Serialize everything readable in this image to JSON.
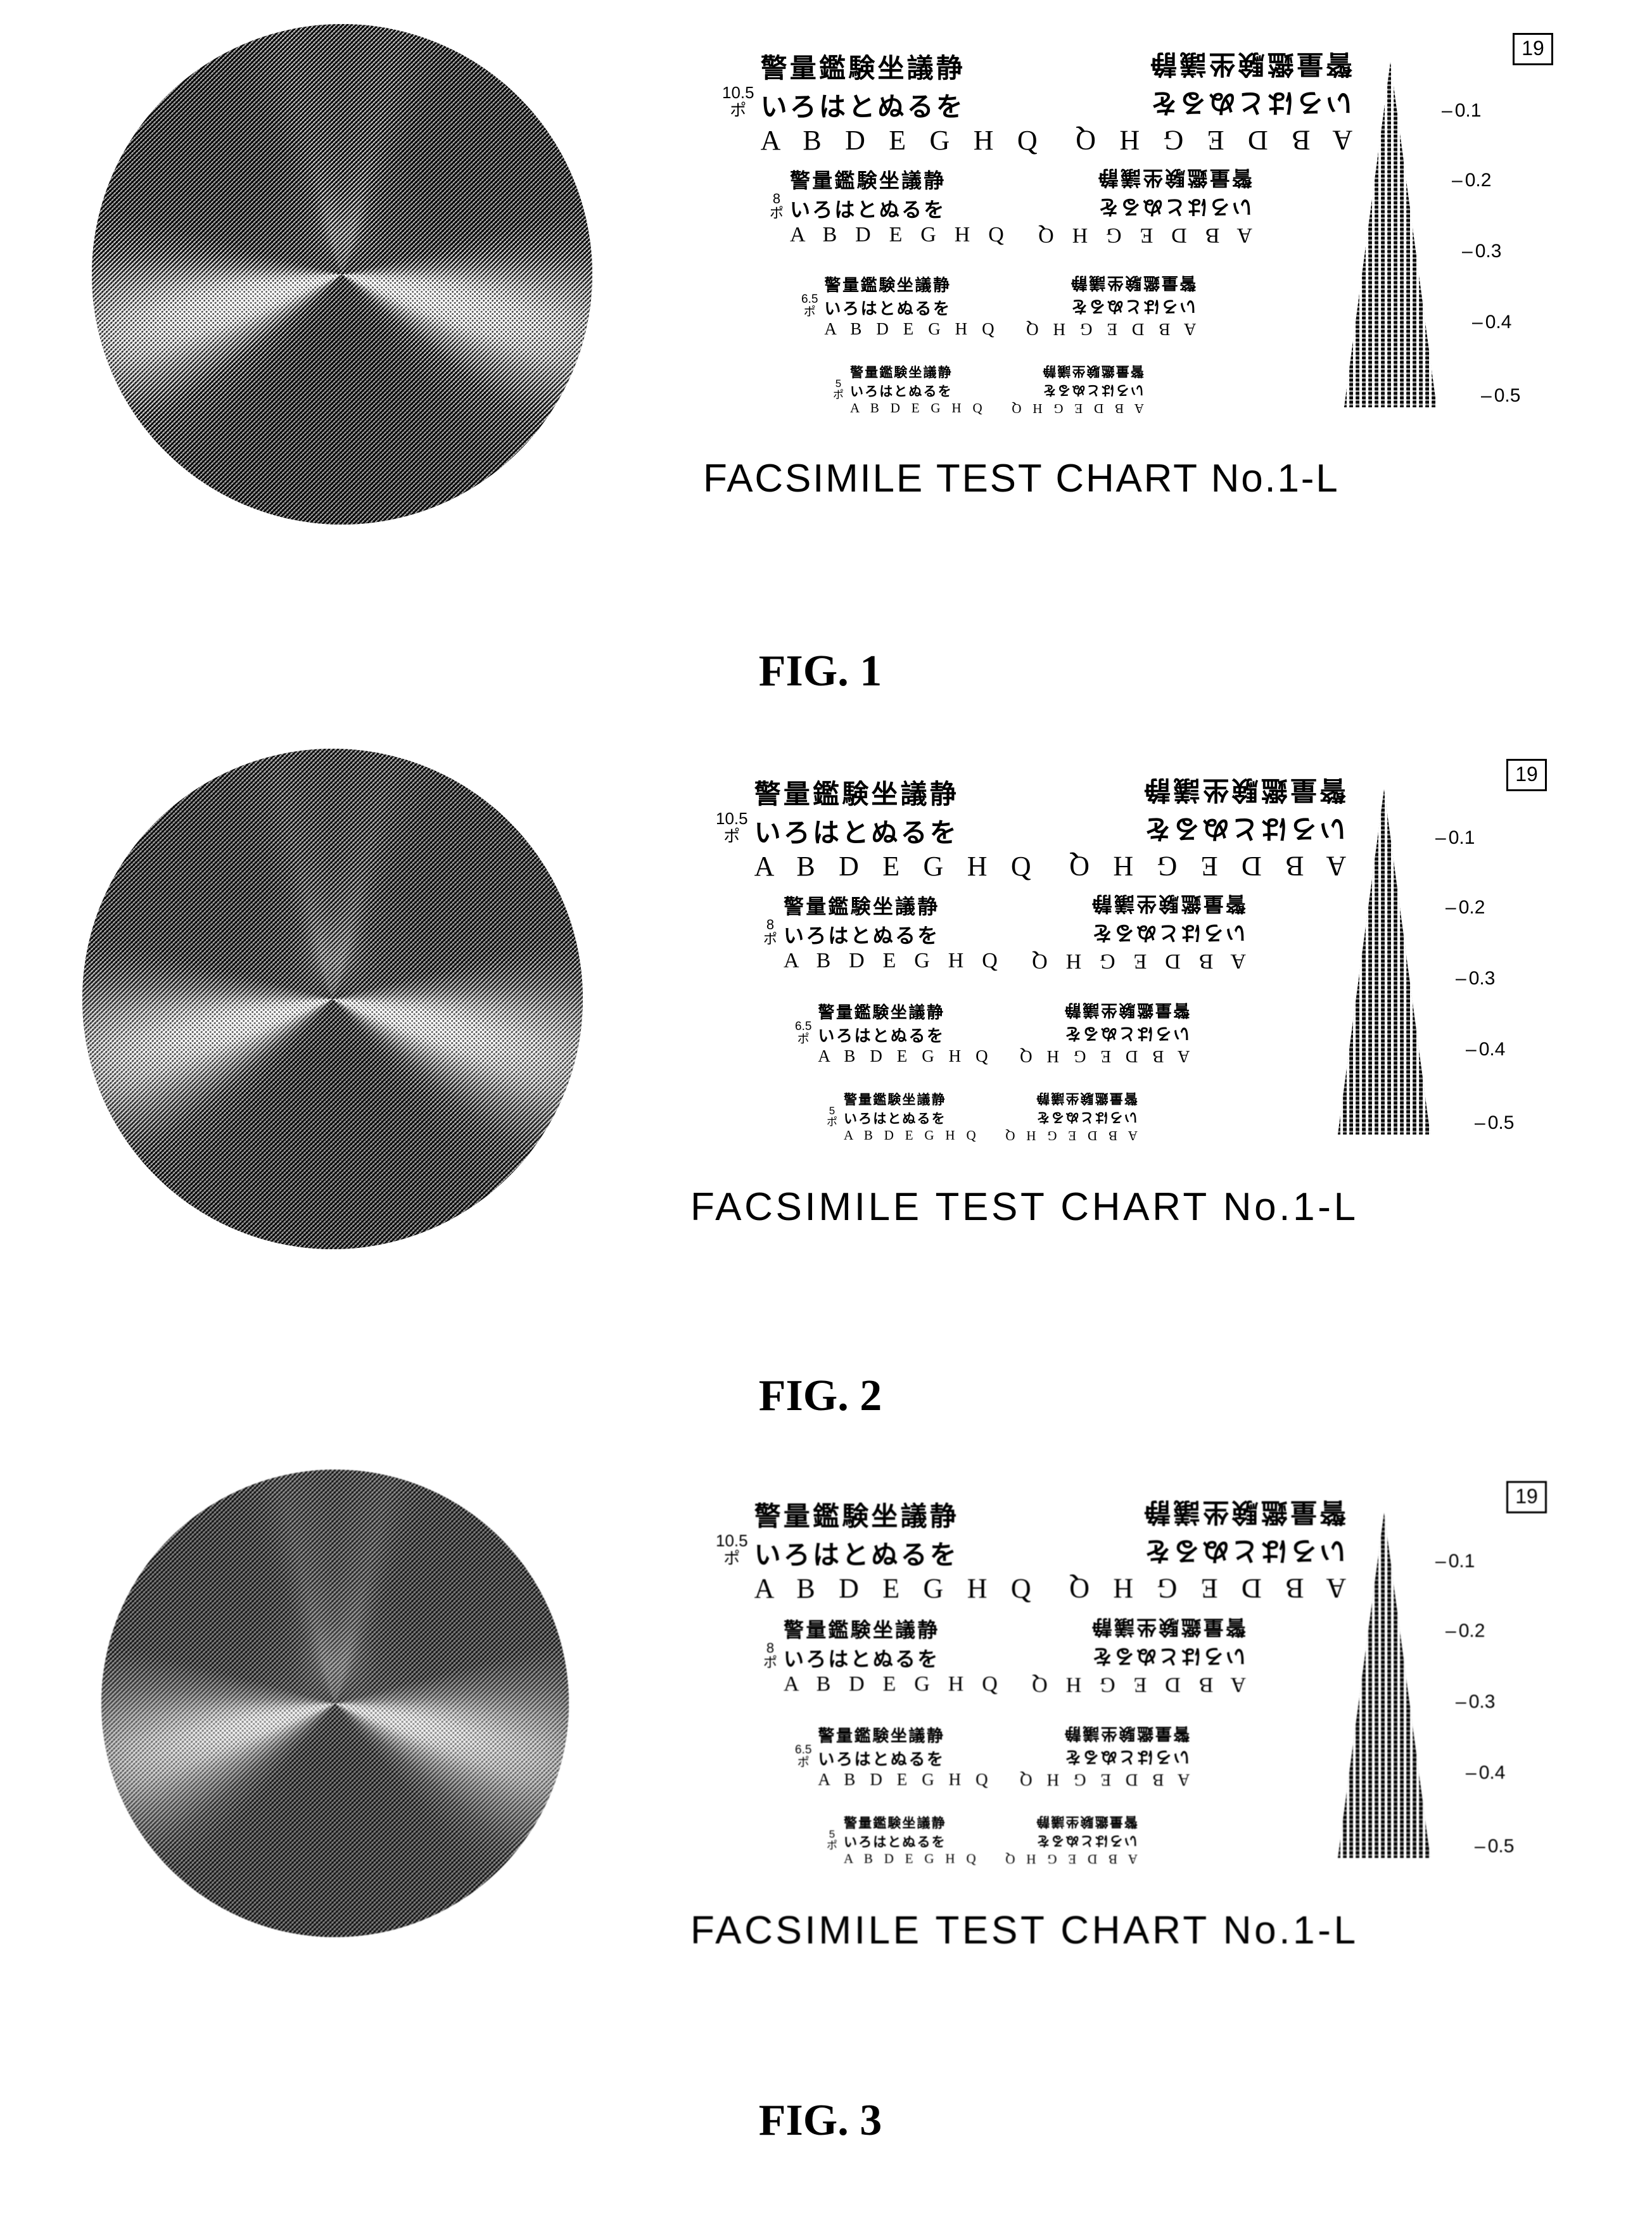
{
  "document": {
    "type": "patent-figure-sheet",
    "figure_count": 3
  },
  "chart_data": {
    "type": "table",
    "title": "FACSIMILE TEST CHART No.1-L",
    "description": "Halftone facsimile test chart reproduction quality comparison across three figures",
    "text_block_point_sizes": [
      "10.5",
      "8",
      "6.5",
      "5"
    ],
    "point_unit": "ポ",
    "text_rows": [
      "警量鑑験坐議静",
      "いろはとぬるを",
      "A B D E G H Q"
    ],
    "resolution_wedge_ticks": [
      "0.1",
      "0.2",
      "0.3",
      "0.4",
      "0.5"
    ],
    "chart_number_box": "19",
    "figure_labels": [
      "FIG. 1",
      "FIG. 2",
      "FIG. 3"
    ]
  },
  "figures": [
    {
      "id": "fig1",
      "label": "FIG. 1",
      "vortex": {
        "name": "halftone-conic-gradient-disc"
      },
      "chart": {
        "caption": "FACSIMILE TEST CHART No.1-L",
        "number_box": "19",
        "point_unit": "ポ",
        "blocks": [
          {
            "size": "10.5",
            "rows": [
              "警量鑑験坐議静",
              "いろはとぬるを",
              "A B D E G H Q"
            ]
          },
          {
            "size": "8",
            "rows": [
              "警量鑑験坐議静",
              "いろはとぬるを",
              "A B D E G H Q"
            ]
          },
          {
            "size": "6.5",
            "rows": [
              "警量鑑験坐議静",
              "いろはとぬるを",
              "A B D E G H Q"
            ]
          },
          {
            "size": "5",
            "rows": [
              "警量鑑験坐議静",
              "いろはとぬるを",
              "A B D E G H Q"
            ]
          }
        ],
        "wedge_ticks": [
          {
            "dash": "–",
            "value": "0.1"
          },
          {
            "dash": "–",
            "value": "0.2"
          },
          {
            "dash": "–",
            "value": "0.3"
          },
          {
            "dash": "–",
            "value": "0.4"
          },
          {
            "dash": "–",
            "value": "0.5"
          }
        ]
      }
    },
    {
      "id": "fig2",
      "label": "FIG. 2",
      "vortex": {
        "name": "halftone-conic-gradient-disc"
      },
      "chart": {
        "caption": "FACSIMILE TEST CHART No.1-L",
        "number_box": "19",
        "point_unit": "ポ",
        "blocks": [
          {
            "size": "10.5",
            "rows": [
              "警量鑑験坐議静",
              "いろはとぬるを",
              "A B D E G H Q"
            ]
          },
          {
            "size": "8",
            "rows": [
              "警量鑑験坐議静",
              "いろはとぬるを",
              "A B D E G H Q"
            ]
          },
          {
            "size": "6.5",
            "rows": [
              "警量鑑験坐議静",
              "いろはとぬるを",
              "A B D E G H Q"
            ]
          },
          {
            "size": "5",
            "rows": [
              "警量鑑験坐議静",
              "いろはとぬるを",
              "A B D E G H Q"
            ]
          }
        ],
        "wedge_ticks": [
          {
            "dash": "–",
            "value": "0.1"
          },
          {
            "dash": "–",
            "value": "0.2"
          },
          {
            "dash": "–",
            "value": "0.3"
          },
          {
            "dash": "–",
            "value": "0.4"
          },
          {
            "dash": "–",
            "value": "0.5"
          }
        ]
      }
    },
    {
      "id": "fig3",
      "label": "FIG. 3",
      "vortex": {
        "name": "halftone-conic-gradient-disc"
      },
      "chart": {
        "caption": "FACSIMILE TEST CHART No.1-L",
        "number_box": "19",
        "point_unit": "ポ",
        "blocks": [
          {
            "size": "10.5",
            "rows": [
              "警量鑑験坐議静",
              "いろはとぬるを",
              "A B D E G H Q"
            ]
          },
          {
            "size": "8",
            "rows": [
              "警量鑑験坐議静",
              "いろはとぬるを",
              "A B D E G H Q"
            ]
          },
          {
            "size": "6.5",
            "rows": [
              "警量鑑験坐議静",
              "いろはとぬるを",
              "A B D E G H Q"
            ]
          },
          {
            "size": "5",
            "rows": [
              "警量鑑験坐議静",
              "いろはとぬるを",
              "A B D E G H Q"
            ]
          }
        ],
        "wedge_ticks": [
          {
            "dash": "–",
            "value": "0.1"
          },
          {
            "dash": "–",
            "value": "0.2"
          },
          {
            "dash": "–",
            "value": "0.3"
          },
          {
            "dash": "–",
            "value": "0.4"
          },
          {
            "dash": "–",
            "value": "0.5"
          }
        ]
      }
    }
  ]
}
